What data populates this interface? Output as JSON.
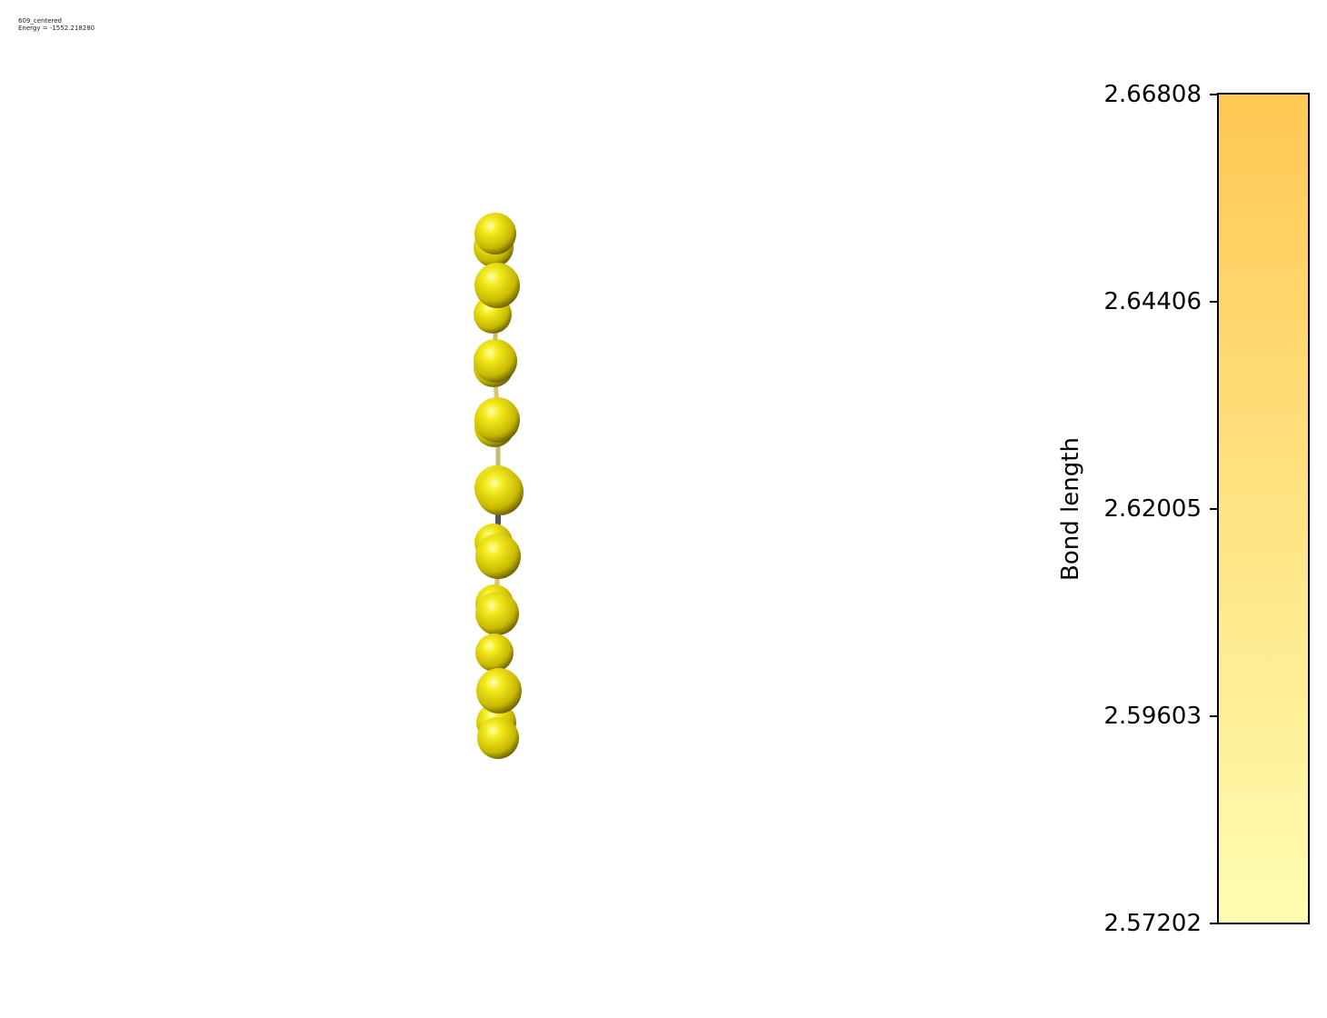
{
  "caption": {
    "name": "609_centered",
    "energy": "Energy = -1552.218280"
  },
  "colorbar": {
    "label": "Bond length",
    "min": 2.57202,
    "max": 2.66808,
    "color_min": "#fffdb0",
    "color_max": "#ffc854",
    "ticks": [
      {
        "value": 2.66808,
        "label": "2.66808"
      },
      {
        "value": 2.64406,
        "label": "2.64406"
      },
      {
        "value": 2.62005,
        "label": "2.62005"
      },
      {
        "value": 2.59603,
        "label": "2.59603"
      },
      {
        "value": 2.57202,
        "label": "2.57202"
      }
    ]
  },
  "atom_color": "#e6d800",
  "bond_color": "#d9c27a"
}
